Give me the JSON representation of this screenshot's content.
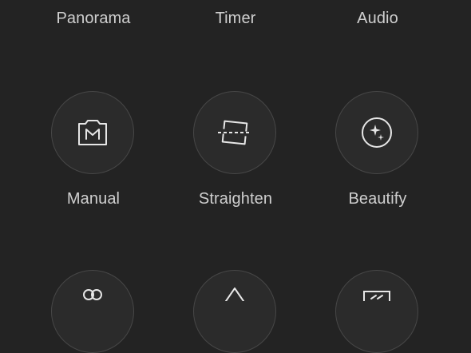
{
  "modes": {
    "row1": [
      {
        "label": "Panorama"
      },
      {
        "label": "Timer"
      },
      {
        "label": "Audio"
      }
    ],
    "row2": [
      {
        "label": "Manual",
        "icon": "manual-icon"
      },
      {
        "label": "Straighten",
        "icon": "straighten-icon"
      },
      {
        "label": "Beautify",
        "icon": "beautify-icon"
      }
    ],
    "row3": [
      {
        "icon": "group-icon"
      },
      {
        "icon": "triangle-icon"
      },
      {
        "icon": "rewind-icon"
      }
    ]
  },
  "colors": {
    "background": "#232323",
    "button_fill": "#2b2b2b",
    "button_border": "#474747",
    "icon": "#e6e6e6",
    "text": "#cfcfcf"
  }
}
